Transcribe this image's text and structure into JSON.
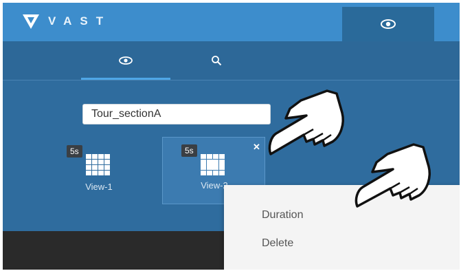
{
  "app": {
    "brand": "VAST",
    "icons": {
      "logo": "vast-logo-icon",
      "top_tab": "eye-icon"
    }
  },
  "subtabs": [
    {
      "icon": "eye-icon",
      "active": true
    },
    {
      "icon": "search-icon",
      "active": false
    }
  ],
  "tour": {
    "name": "Tour_sectionA"
  },
  "views": [
    {
      "label": "View-1",
      "duration": "5s",
      "selected": false
    },
    {
      "label": "View-2",
      "duration": "5s",
      "selected": true,
      "close_icon": "close-icon"
    }
  ],
  "context_menu": {
    "items": [
      "Duration",
      "Delete"
    ]
  },
  "colors": {
    "topbar": "#3d8dcc",
    "panel": "#2f6c9e",
    "active_tab": "#2a6a9a",
    "accent": "#4ea6e6",
    "menu": "#f4f4f4"
  }
}
